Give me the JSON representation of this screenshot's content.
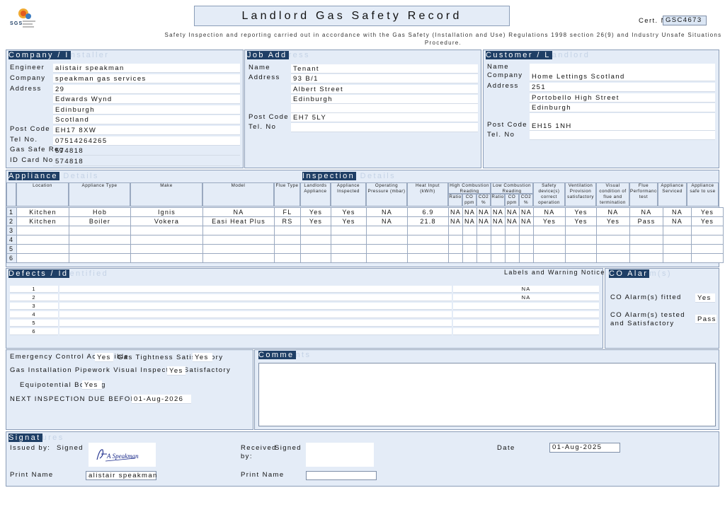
{
  "header": {
    "logo_text": "SGS",
    "title": "Landlord Gas Safety Record",
    "cert_label": "Cert. No",
    "cert_no": "GSC4673",
    "regulation": "Safety Inspection and reporting carried out in accordance with the Gas Safety (Installation and Use) Regulations 1998 section 26(9) and Industry Unsafe Situations Procedure."
  },
  "company": {
    "heading_dark": "Company / I",
    "heading_light": "nstaller",
    "labels": {
      "engineer": "Engineer",
      "company": "Company",
      "address": "Address",
      "postcode": "Post Code",
      "tel": "Tel No.",
      "gas_safe": "Gas Safe Reg",
      "id_card": "ID Card No"
    },
    "engineer": "alistair speakman",
    "company": "speakman gas services",
    "address": [
      "29",
      "Edwards Wynd",
      "Edinburgh",
      "Scotland"
    ],
    "postcode": "EH17 8XW",
    "tel": "07514264265",
    "gas_safe": "574818",
    "id_card": "574818"
  },
  "job": {
    "heading_dark": "Job Add",
    "heading_light": "ress",
    "labels": {
      "name": "Name",
      "address": "Address",
      "postcode": "Post Code",
      "tel": "Tel. No"
    },
    "name": "Tenant",
    "address": [
      "93 B/1",
      "Albert Street",
      "Edinburgh",
      ""
    ],
    "postcode": "EH7 5LY",
    "tel": ""
  },
  "customer": {
    "heading_dark": "Customer / L",
    "heading_light": "andlord",
    "labels": {
      "name": "Name",
      "company": "Company",
      "address": "Address",
      "postcode": "Post Code",
      "tel": "Tel. No"
    },
    "name": "",
    "company": "Home Lettings Scotland",
    "address": [
      "251",
      "Portobello High Street",
      "Edinburgh",
      ""
    ],
    "postcode": "EH15 1NH",
    "tel": ""
  },
  "appliance": {
    "heading_dark": "Appliance",
    "heading_light": " Details",
    "inspection_dark": "Inspection",
    "inspection_light": " Details",
    "columns": [
      "Location",
      "Appliance Type",
      "Make",
      "Model",
      "Flue Type",
      "Landlords Appliance",
      "Appliance Inspected",
      "Operating Pressure (mbar)",
      "Heat Input (kW/h)",
      "High Combustion Reading",
      "Low Combustion Reading",
      "Safety device(s) correct operation",
      "Ventilation Provision satisfactory",
      "Visual condition of flue and termination satisfactory",
      "Flue Performance test",
      "Appliance Serviced",
      "Appliance safe to use"
    ],
    "sub_columns": [
      "Ratio",
      "CO ppm",
      "CO2 %",
      "Ratio",
      "CO ppm",
      "CO2 %"
    ],
    "rows": [
      {
        "n": "1",
        "location": "Kitchen",
        "type": "Hob",
        "make": "Ignis",
        "model": "NA",
        "flue": "FL",
        "landlords": "Yes",
        "inspected": "Yes",
        "pressure": "NA",
        "heat": "6.9",
        "h1": "NA",
        "h2": "NA",
        "h3": "NA",
        "l1": "NA",
        "l2": "NA",
        "l3": "NA",
        "safety": "NA",
        "vent": "Yes",
        "visual": "NA",
        "flue_test": "NA",
        "serviced": "NA",
        "safe": "Yes"
      },
      {
        "n": "2",
        "location": "Kitchen",
        "type": "Boiler",
        "make": "Vokera",
        "model": "Easi Heat Plus",
        "flue": "RS",
        "landlords": "Yes",
        "inspected": "Yes",
        "pressure": "NA",
        "heat": "21.8",
        "h1": "NA",
        "h2": "NA",
        "h3": "NA",
        "l1": "NA",
        "l2": "NA",
        "l3": "NA",
        "safety": "Yes",
        "vent": "Yes",
        "visual": "Yes",
        "flue_test": "Pass",
        "serviced": "NA",
        "safe": "Yes"
      },
      {
        "n": "3"
      },
      {
        "n": "4"
      },
      {
        "n": "5"
      },
      {
        "n": "6"
      }
    ]
  },
  "defects": {
    "heading_dark": "Defects / Id",
    "heading_light": "entified",
    "labels_warning": "Labels and Warning Notices",
    "rows": [
      {
        "n": "1",
        "note": "NA"
      },
      {
        "n": "2",
        "note": "NA"
      },
      {
        "n": "3",
        "note": ""
      },
      {
        "n": "4",
        "note": ""
      },
      {
        "n": "5",
        "note": ""
      },
      {
        "n": "6",
        "note": ""
      }
    ]
  },
  "co_alarm": {
    "heading_dark": "CO Alar",
    "heading_light": "m(s)",
    "fitted_label": "CO Alarm(s) fitted",
    "fitted": "Yes",
    "tested_label": "CO Alarm(s) tested and Satisfactory",
    "tested": "Pass"
  },
  "checks": {
    "emergency_label": "Emergency Control Accessible",
    "emergency": "Yes",
    "tightness_label": "Gas Tightness Satisfactory",
    "tightness": "Yes",
    "pipework_label": "Gas Installation Pipework Visual Inspection Satisfactory",
    "pipework": "Yes",
    "bonding_label": "Equipotential Bonding",
    "bonding": "Yes",
    "next_label": "NEXT INSPECTION DUE BEFORE",
    "next_date": "01-Aug-2026"
  },
  "comments": {
    "heading_dark": "Comme",
    "heading_light": "nts",
    "text": ""
  },
  "signature": {
    "heading_dark": "Signat",
    "heading_light": "ures",
    "issued_label": "Issued by:",
    "signed_label": "Signed",
    "signature_script": "A Speakman",
    "print_label": "Print Name",
    "issuer_name": "alistair speakman",
    "received_label": "Received by:",
    "received_signed_label": "Signed",
    "received_print_label": "Print Name",
    "date_label": "Date",
    "date": "01-Aug-2025"
  }
}
